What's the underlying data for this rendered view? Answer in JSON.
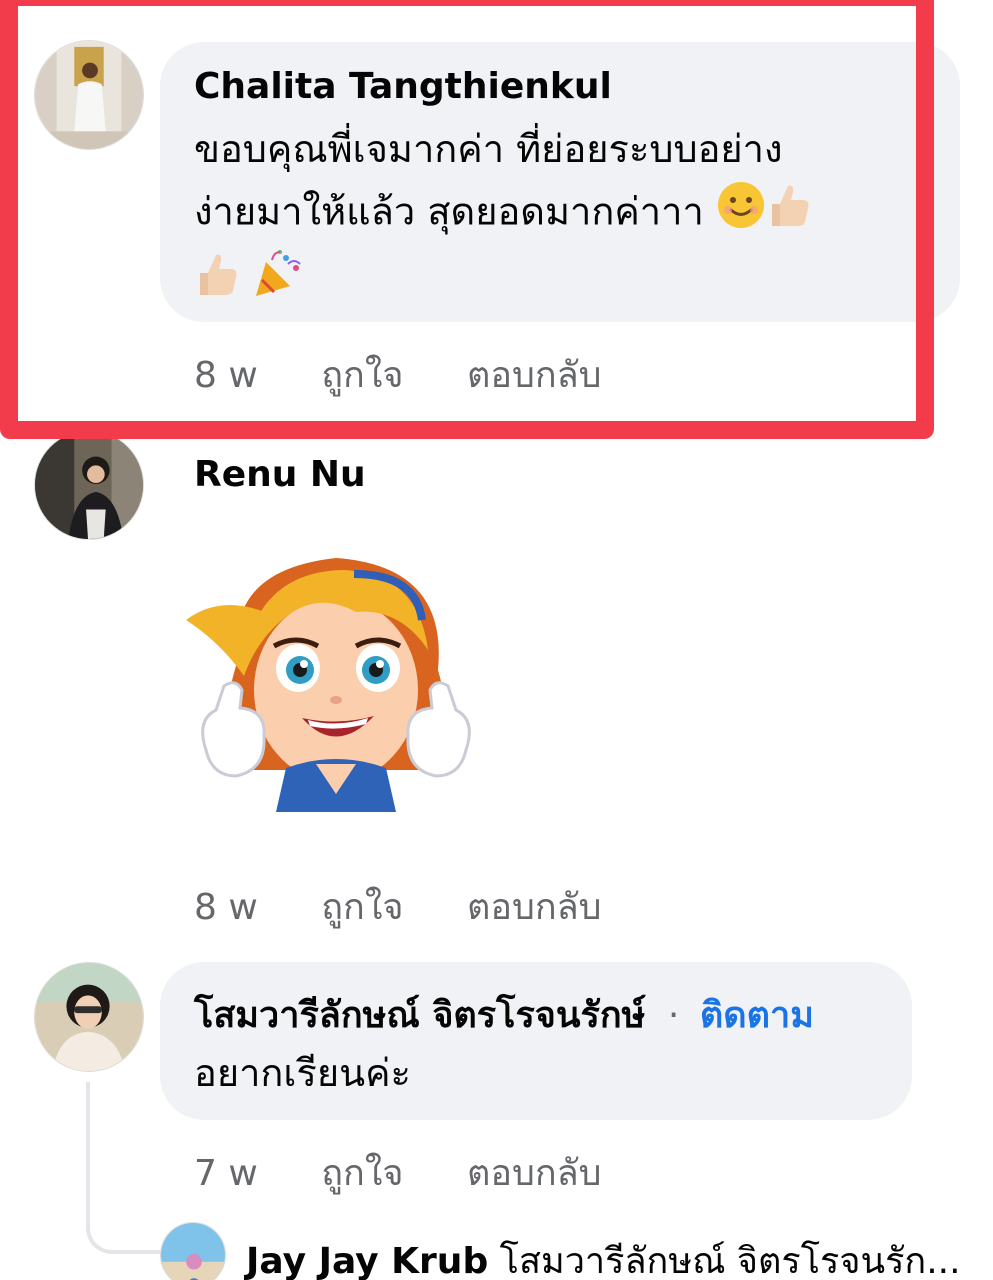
{
  "comments": [
    {
      "author": "Chalita Tangthienkul",
      "text_line1": "ขอบคุณพี่เจมากค่า ที่ย่อยระบบอย่าง",
      "text_line2": "ง่ายมาให้แล้ว สุดยอดมากค่าาา",
      "time": "8 w",
      "like_label": "ถูกใจ",
      "reply_label": "ตอบกลับ",
      "emojis": [
        "smiling-face-emoji",
        "thumbs-up-emoji",
        "thumbs-up-emoji",
        "party-popper-emoji"
      ]
    },
    {
      "author": "Renu Nu",
      "sticker": "thumbs-up-girl-sticker",
      "time": "8 w",
      "like_label": "ถูกใจ",
      "reply_label": "ตอบกลับ"
    },
    {
      "author": "โสมวารีลักษณ์ จิตรโรจนรักษ์",
      "separator": "·",
      "follow_label": "ติดตาม",
      "text": "อยากเรียนค่ะ",
      "time": "7 w",
      "like_label": "ถูกใจ",
      "reply_label": "ตอบกลับ"
    }
  ],
  "reply_preview": {
    "author": "Jay Jay Krub",
    "text": "โสมวารีลักษณ์ จิตรโรจนรัก..."
  },
  "colors": {
    "highlight": "#f23c4b",
    "bubble": "#f0f2f5",
    "follow": "#1b74e4",
    "meta": "#65676b"
  }
}
